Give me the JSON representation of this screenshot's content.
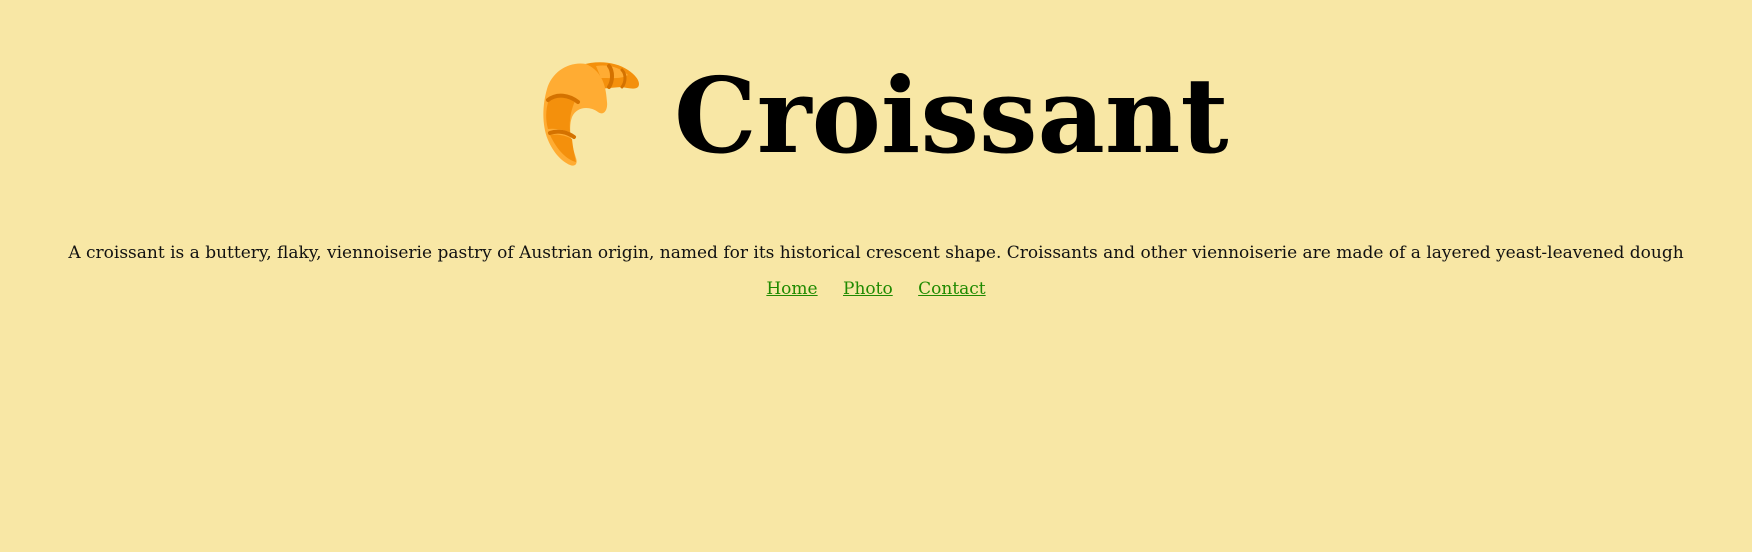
{
  "header": {
    "title": "Croissant",
    "logo_icon": "croissant-icon"
  },
  "main": {
    "description": "A croissant is a buttery, flaky, viennoiserie pastry of Austrian origin, named for its historical crescent shape. Croissants and other viennoiserie are made of a layered yeast-leavened dough"
  },
  "nav": {
    "items": [
      {
        "label": "Home"
      },
      {
        "label": "Photo"
      },
      {
        "label": "Contact"
      }
    ]
  },
  "colors": {
    "background": "#f8e7a5",
    "link": "#1f8a00",
    "croissant_main": "#ffac33",
    "croissant_shadow": "#f4900c",
    "croissant_dark": "#d47200"
  }
}
